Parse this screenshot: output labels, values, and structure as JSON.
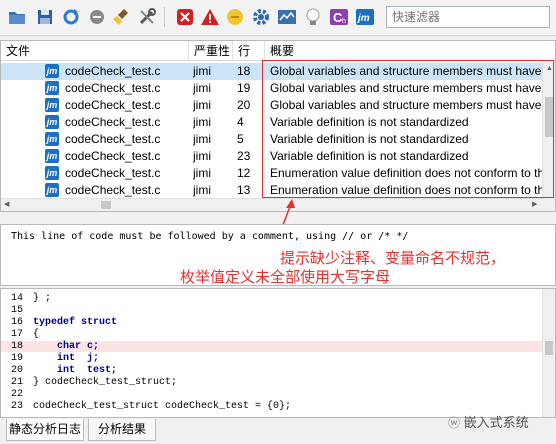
{
  "toolbar": {
    "icons": [
      "open-folder-icon",
      "save-icon",
      "refresh-icon",
      "stop-icon",
      "clean-icon",
      "tools-icon",
      "error-icon",
      "warning-icon",
      "info-icon",
      "settings-icon",
      "chart-icon",
      "hint-icon",
      "c-language-icon",
      "jm-icon"
    ],
    "search_placeholder": "快速滤器"
  },
  "list": {
    "columns": [
      "文件",
      "严重性",
      "行",
      "概要"
    ],
    "rows": [
      {
        "file": "codeCheck_test.c",
        "severity": "jimi",
        "line": "18",
        "summary": "Global variables and structure members must have corr",
        "selected": true
      },
      {
        "file": "codeCheck_test.c",
        "severity": "jimi",
        "line": "19",
        "summary": "Global variables and structure members must have corr",
        "selected": false
      },
      {
        "file": "codeCheck_test.c",
        "severity": "jimi",
        "line": "20",
        "summary": "Global variables and structure members must have corr",
        "selected": false
      },
      {
        "file": "codeCheck_test.c",
        "severity": "jimi",
        "line": "4",
        "summary": "Variable definition is not standardized",
        "selected": false
      },
      {
        "file": "codeCheck_test.c",
        "severity": "jimi",
        "line": "5",
        "summary": "Variable definition is not standardized",
        "selected": false
      },
      {
        "file": "codeCheck_test.c",
        "severity": "jimi",
        "line": "23",
        "summary": "Variable definition is not standardized",
        "selected": false
      },
      {
        "file": "codeCheck_test.c",
        "severity": "jimi",
        "line": "12",
        "summary": "Enumeration value definition does not conform to the",
        "selected": false
      },
      {
        "file": "codeCheck_test.c",
        "severity": "jimi",
        "line": "13",
        "summary": "Enumeration value definition does not conform to the",
        "selected": false
      }
    ]
  },
  "annotation": {
    "line1": "提示缺少注释、变量命名不规范，",
    "line2": "枚举值定义未全部使用大写字母"
  },
  "message": "This line of code must be followed by a comment, using // or /* */",
  "code_lines": [
    {
      "n": "14",
      "text": "} ;",
      "kw": false,
      "hl": false
    },
    {
      "n": "15",
      "text": "",
      "kw": false,
      "hl": false
    },
    {
      "n": "16",
      "text": "typedef struct",
      "kw": true,
      "hl": false
    },
    {
      "n": "17",
      "text": "{",
      "kw": false,
      "hl": false
    },
    {
      "n": "18",
      "text": "    char c;",
      "kw": true,
      "hl": true
    },
    {
      "n": "19",
      "text": "    int  j;",
      "kw": true,
      "hl": false
    },
    {
      "n": "20",
      "text": "    int  test;",
      "kw": true,
      "hl": false
    },
    {
      "n": "21",
      "text": "} codeCheck_test_struct;",
      "kw": false,
      "hl": false
    },
    {
      "n": "22",
      "text": "",
      "kw": false,
      "hl": false
    },
    {
      "n": "23",
      "text": "codeCheck_test_struct codeCheck_test = {0};",
      "kw": false,
      "hl": false
    }
  ],
  "tabs": [
    "静态分析日志",
    "分析结果"
  ],
  "watermark": "嵌入式系统",
  "colors": {
    "selection": "#cce4f7",
    "annotation": "#e5312f",
    "highlight_line": "#fde3e3",
    "keyword": "#00008b"
  }
}
